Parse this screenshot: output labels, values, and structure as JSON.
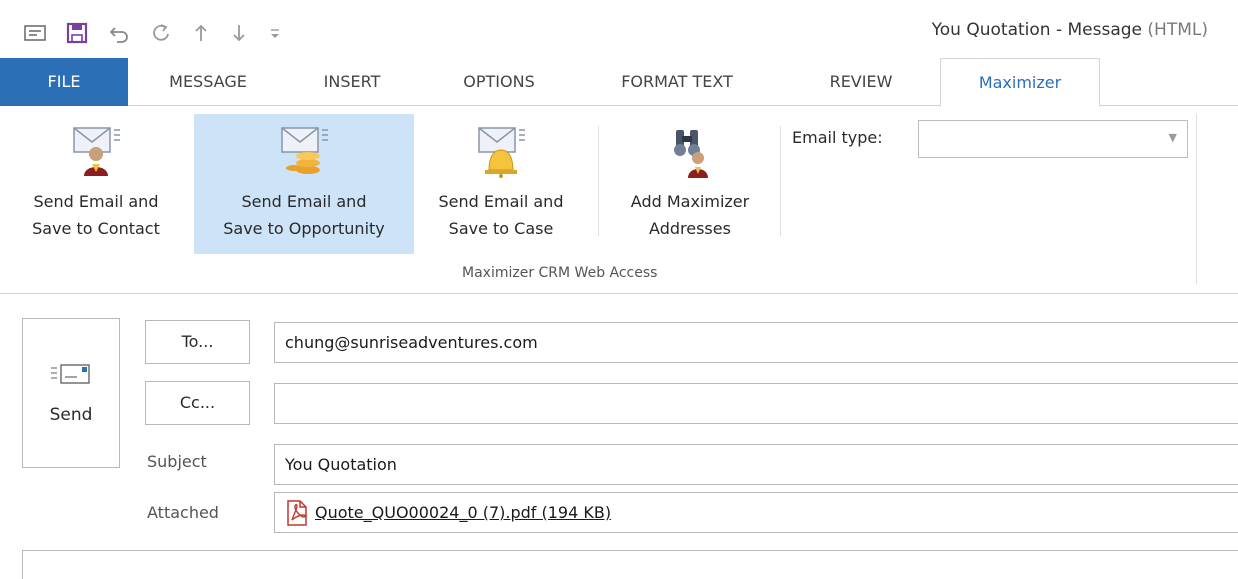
{
  "window": {
    "title": "You Quotation - Message",
    "title_suffix": " (HTML)"
  },
  "tabs": [
    {
      "label": "FILE"
    },
    {
      "label": "MESSAGE"
    },
    {
      "label": "INSERT"
    },
    {
      "label": "OPTIONS"
    },
    {
      "label": "FORMAT TEXT"
    },
    {
      "label": "REVIEW"
    },
    {
      "label": "Maximizer"
    }
  ],
  "ribbon": {
    "buttons": [
      {
        "label": "Send Email and\nSave to Contact"
      },
      {
        "label": "Send Email and\nSave to Opportunity"
      },
      {
        "label": "Send Email and\nSave to Case"
      },
      {
        "label": "Add Maximizer\nAddresses"
      }
    ],
    "group_label": "Maximizer CRM Web Access",
    "email_type_label": "Email type:",
    "email_type_value": ""
  },
  "compose": {
    "send_label": "Send",
    "to_button": "To...",
    "cc_button": "Cc...",
    "to_value": "chung@sunriseadventures.com",
    "cc_value": "",
    "subject_label": "Subject",
    "subject_value": "You Quotation",
    "attached_label": "Attached",
    "attachment": "Quote_QUO00024_0 (7).pdf (194 KB)"
  },
  "colors": {
    "file_tab": "#2b6fb7",
    "active_tab_text": "#2b6fb7",
    "hover_button": "#cde3f7",
    "save_icon": "#7b3fa0"
  }
}
